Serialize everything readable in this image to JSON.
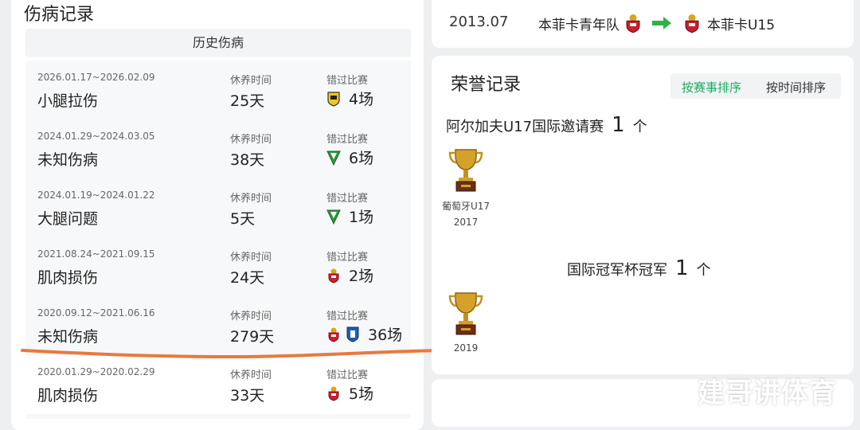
{
  "injury_section": {
    "title": "伤病记录",
    "history_header": "历史伤病",
    "rest_label": "休养时间",
    "missed_label": "错过比赛",
    "records": [
      {
        "date": "2026.01.17~2026.02.09",
        "name": "小腿拉伤",
        "rest": "25天",
        "missed": "4场",
        "badges": [
          "club-yellow-icon"
        ]
      },
      {
        "date": "2024.01.29~2024.03.05",
        "name": "未知伤病",
        "rest": "38天",
        "missed": "6场",
        "badges": [
          "club-green-icon"
        ]
      },
      {
        "date": "2024.01.19~2024.01.22",
        "name": "大腿问题",
        "rest": "5天",
        "missed": "1场",
        "badges": [
          "club-green-icon"
        ]
      },
      {
        "date": "2021.08.24~2021.09.15",
        "name": "肌肉损伤",
        "rest": "24天",
        "missed": "2场",
        "badges": [
          "benfica-icon"
        ]
      },
      {
        "date": "2020.09.12~2021.06.16",
        "name": "未知伤病",
        "rest": "279天",
        "missed": "36场",
        "badges": [
          "benfica-icon",
          "club-blue-icon"
        ]
      },
      {
        "date": "2020.01.29~2020.02.29",
        "name": "肌肉损伤",
        "rest": "33天",
        "missed": "5场",
        "badges": [
          "benfica-icon"
        ]
      }
    ]
  },
  "transfer": {
    "date": "2013.07",
    "from": "本菲卡青年队",
    "to": "本菲卡U15"
  },
  "honors": {
    "title": "荣誉记录",
    "sort_by_competition": "按赛事排序",
    "sort_by_time": "按时间排序",
    "count_unit": "个",
    "competitions": [
      {
        "name": "阿尔加夫U17国际邀请赛",
        "count": "1",
        "trophies": [
          {
            "team": "葡萄牙U17",
            "year": "2017"
          }
        ]
      },
      {
        "name": "国际冠军杯冠军",
        "count": "1",
        "trophies": [
          {
            "team": "",
            "year": "2019"
          }
        ]
      }
    ]
  },
  "watermark": "建哥讲体育",
  "colors": {
    "accent_green": "#1aad5e",
    "annotation_orange": "#e8793f",
    "transfer_arrow": "#2db24a"
  }
}
